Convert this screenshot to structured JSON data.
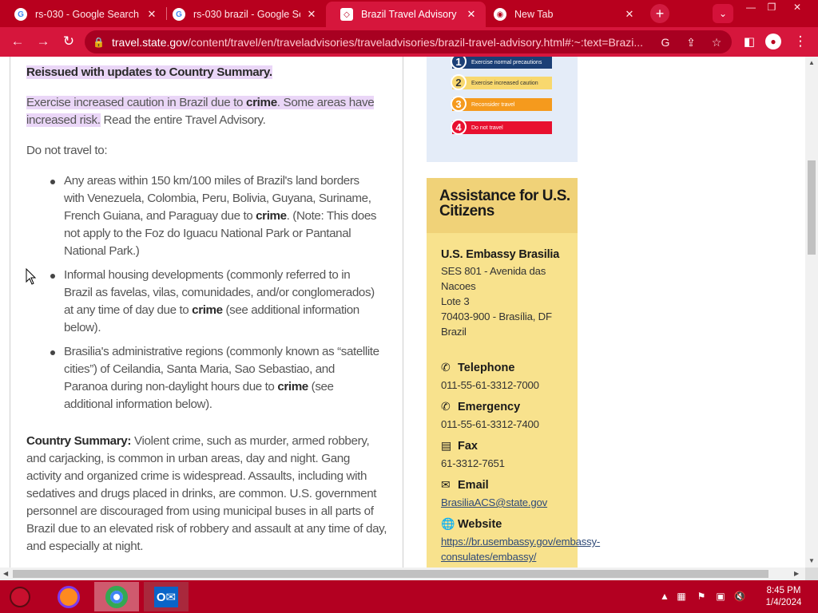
{
  "browser": {
    "tabs": [
      {
        "title": "rs-030 - Google Search",
        "favicon": "google-icon",
        "active": false
      },
      {
        "title": "rs-030 brazil - Google Se",
        "favicon": "google-icon",
        "active": false
      },
      {
        "title": "Brazil Travel Advisory",
        "favicon": "state-dept-icon",
        "active": true
      },
      {
        "title": "New Tab",
        "favicon": "chrome-icon",
        "active": false
      }
    ],
    "new_tab_symbol": "+",
    "close_symbol": "✕",
    "address_host": "travel.state.gov",
    "address_path": "/content/travel/en/traveladvisories/traveladvisories/brazil-travel-advisory.html#:~:text=Brazi..."
  },
  "main": {
    "reissued": "Reissued with updates to Country Summary.",
    "caution_pre": "Exercise increased caution in Brazil due to ",
    "caution_bold": "crime",
    "caution_post": ". Some areas have increased risk.",
    "read_entire": " Read the entire Travel Advisory.",
    "do_not_travel": "Do not travel to:",
    "bullets": [
      {
        "pre": "Any areas within 150 km/100 miles of Brazil's land borders with Venezuela, Colombia, Peru, Bolivia, Guyana, Suriname, French Guiana, and Paraguay due to ",
        "bold": "crime",
        "post": ". (Note: This does not apply to the Foz do Iguacu National Park or Pantanal National Park.)"
      },
      {
        "pre": "Informal housing developments (commonly referred to in Brazil as favelas, vilas, comunidades, and/or conglomerados) at any time of day due to ",
        "bold": "crime",
        "post": " (see additional information below)."
      },
      {
        "pre": "Brasilia's administrative regions (commonly known as “satellite cities”) of Ceilandia, Santa Maria, Sao Sebastiao, and Paranoa during non-daylight hours due to ",
        "bold": "crime",
        "post": " (see additional information below)."
      }
    ],
    "summary_label": "Country Summary:",
    "summary_text": "  Violent crime, such as murder, armed robbery, and carjacking, is common in urban areas, day and night. Gang activity and organized crime is widespread. Assaults, including with sedatives and drugs placed in drinks, are common. U.S. government personnel are discouraged from using municipal buses in all parts of Brazil due to an elevated risk of robbery and assault at any time of day, and especially at night."
  },
  "levels": [
    {
      "num": "1",
      "label": "Exercise normal precautions",
      "color": "#1b3f76",
      "text_color": "#ffffff"
    },
    {
      "num": "2",
      "label": "Exercise increased caution",
      "color": "#f8d86e",
      "text_color": "#333333"
    },
    {
      "num": "3",
      "label": "Reconsider travel",
      "color": "#f59a1d",
      "text_color": "#ffffff"
    },
    {
      "num": "4",
      "label": "Do not travel",
      "color": "#e8102f",
      "text_color": "#ffffff"
    }
  ],
  "assistance": {
    "heading": "Assistance for U.S. Citizens",
    "embassy_name": "U.S. Embassy Brasilia",
    "address": [
      "SES 801 - Avenida das",
      "Nacoes",
      "Lote 3",
      "70403-900 - Brasília, DF",
      "Brazil"
    ],
    "telephone_label": "Telephone",
    "telephone": "011-55-61-3312-7000",
    "emergency_label": "Emergency",
    "emergency": "011-55-61-3312-7400",
    "fax_label": "Fax",
    "fax": "61-3312-7651",
    "email_label": "Email",
    "email": "BrasiliaACS@state.gov",
    "website_label": "Website",
    "website_line1": "https://br.usembassy.gov/embassy-",
    "website_line2": "consulates/embassy/"
  },
  "taskbar": {
    "clock_time": "8:45 PM",
    "clock_date": "1/4/2024"
  }
}
